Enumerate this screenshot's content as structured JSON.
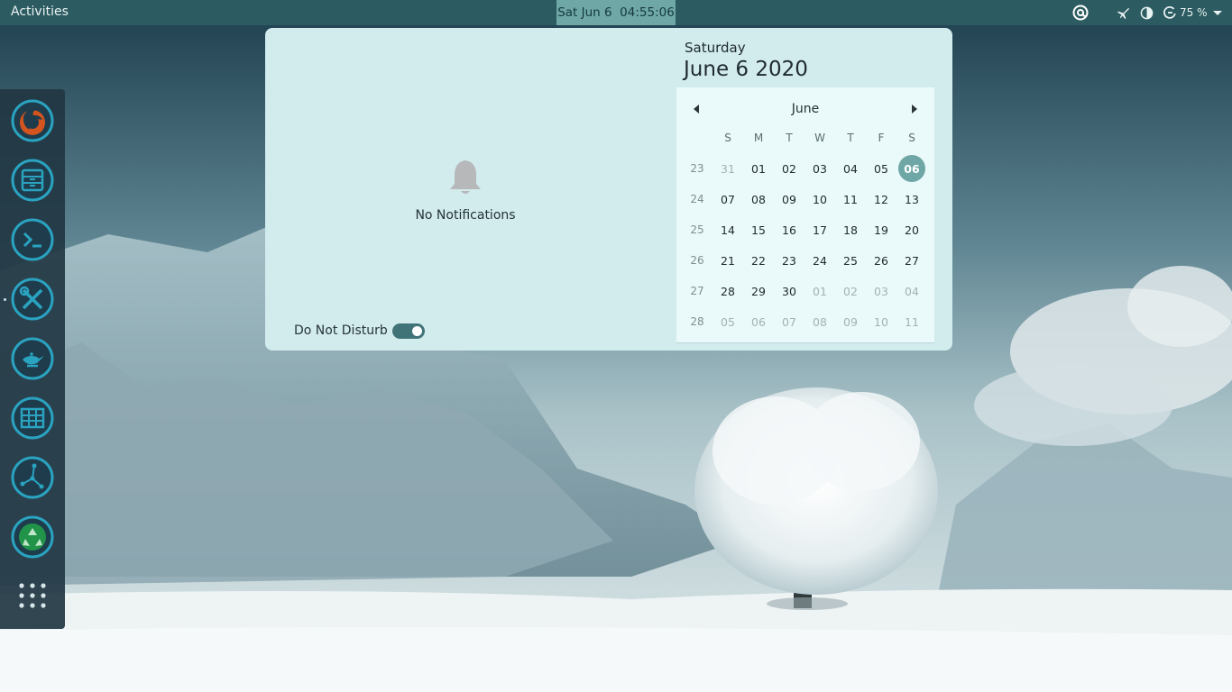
{
  "topbar": {
    "activities_label": "Activities",
    "clock_text": "Sat Jun 6  04:55:06",
    "battery_percent": "75 %",
    "tray_icons": [
      "at-sign-icon",
      "airplane-mode-icon",
      "night-light-icon",
      "power-icon",
      "dropdown-arrow-icon"
    ]
  },
  "dock": {
    "items": [
      {
        "name": "firefox-launcher",
        "icon": "firefox-icon"
      },
      {
        "name": "files-launcher",
        "icon": "file-cabinet-icon"
      },
      {
        "name": "terminal-launcher",
        "icon": "terminal-icon"
      },
      {
        "name": "settings-launcher",
        "icon": "tools-icon"
      },
      {
        "name": "genie-launcher",
        "icon": "genie-lamp-icon"
      },
      {
        "name": "spreadsheet-launcher",
        "icon": "spreadsheet-icon"
      },
      {
        "name": "network-launcher",
        "icon": "graph-nodes-icon"
      },
      {
        "name": "trash-launcher",
        "icon": "recycle-icon"
      },
      {
        "name": "show-applications",
        "icon": "app-grid-icon"
      }
    ]
  },
  "notifications": {
    "empty_text": "No Notifications",
    "dnd_label": "Do Not Disturb",
    "dnd_enabled": true
  },
  "calendar": {
    "weekday_full": "Saturday",
    "date_full": "June 6 2020",
    "month_label": "June",
    "weekday_headers": [
      "S",
      "M",
      "T",
      "W",
      "T",
      "F",
      "S"
    ],
    "weeks": [
      {
        "num": "23",
        "days": [
          "31",
          "01",
          "02",
          "03",
          "04",
          "05",
          "06"
        ]
      },
      {
        "num": "24",
        "days": [
          "07",
          "08",
          "09",
          "10",
          "11",
          "12",
          "13"
        ]
      },
      {
        "num": "25",
        "days": [
          "14",
          "15",
          "16",
          "17",
          "18",
          "19",
          "20"
        ]
      },
      {
        "num": "26",
        "days": [
          "21",
          "22",
          "23",
          "24",
          "25",
          "26",
          "27"
        ]
      },
      {
        "num": "27",
        "days": [
          "28",
          "29",
          "30",
          "01",
          "02",
          "03",
          "04"
        ]
      },
      {
        "num": "28",
        "days": [
          "05",
          "06",
          "07",
          "08",
          "09",
          "10",
          "11"
        ]
      }
    ],
    "today": "06",
    "colors": {
      "accent": "#6ea7a6",
      "popover_bg": "#d2ebed",
      "calendar_bg": "#eaf9f9",
      "topbar_bg": "#2c5b61",
      "dock_bg": "#223743"
    }
  }
}
